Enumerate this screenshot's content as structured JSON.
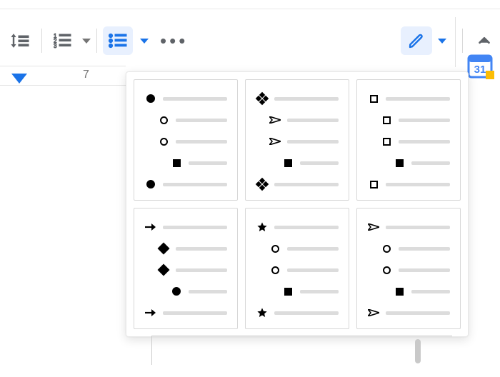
{
  "toolbar": {
    "line_spacing": "line-spacing",
    "numbered_list": "numbered-list",
    "bulleted_list": "bulleted-list",
    "more": "more-options",
    "edit_mode": "editing-mode",
    "collapse": "hide-menus"
  },
  "ruler": {
    "tick_label": "7"
  },
  "sidebar": {
    "calendar_day": "31"
  },
  "bullet_presets": [
    {
      "id": "disc-circle-square",
      "levels": [
        "filled-circle",
        "hollow-circle",
        "hollow-circle",
        "filled-square",
        "filled-circle"
      ],
      "indent": [
        0,
        1,
        1,
        2,
        0
      ]
    },
    {
      "id": "fourdiamond-send-square",
      "levels": [
        "four-diamond",
        "send-arrow",
        "send-arrow",
        "filled-square",
        "four-diamond"
      ],
      "indent": [
        0,
        1,
        1,
        2,
        0
      ]
    },
    {
      "id": "hollowsquare-hollowsquare-square",
      "levels": [
        "hollow-square",
        "hollow-square",
        "hollow-square",
        "filled-square",
        "hollow-square"
      ],
      "indent": [
        0,
        1,
        1,
        2,
        0
      ]
    },
    {
      "id": "arrow-diamond-circle",
      "levels": [
        "right-arrow",
        "filled-diamond",
        "filled-diamond",
        "filled-circle",
        "right-arrow"
      ],
      "indent": [
        0,
        1,
        1,
        2,
        0
      ]
    },
    {
      "id": "star-circle-square",
      "levels": [
        "filled-star",
        "hollow-circle",
        "hollow-circle",
        "filled-square",
        "filled-star"
      ],
      "indent": [
        0,
        1,
        1,
        2,
        0
      ]
    },
    {
      "id": "send-circle-square",
      "levels": [
        "send-arrow",
        "hollow-circle",
        "hollow-circle",
        "filled-square",
        "send-arrow"
      ],
      "indent": [
        0,
        1,
        1,
        2,
        0
      ]
    }
  ],
  "colors": {
    "accent": "#1a73e8",
    "icon_grey": "#5f6368",
    "calendar_blue": "#4285f4",
    "calendar_yellow": "#fbbc04"
  }
}
